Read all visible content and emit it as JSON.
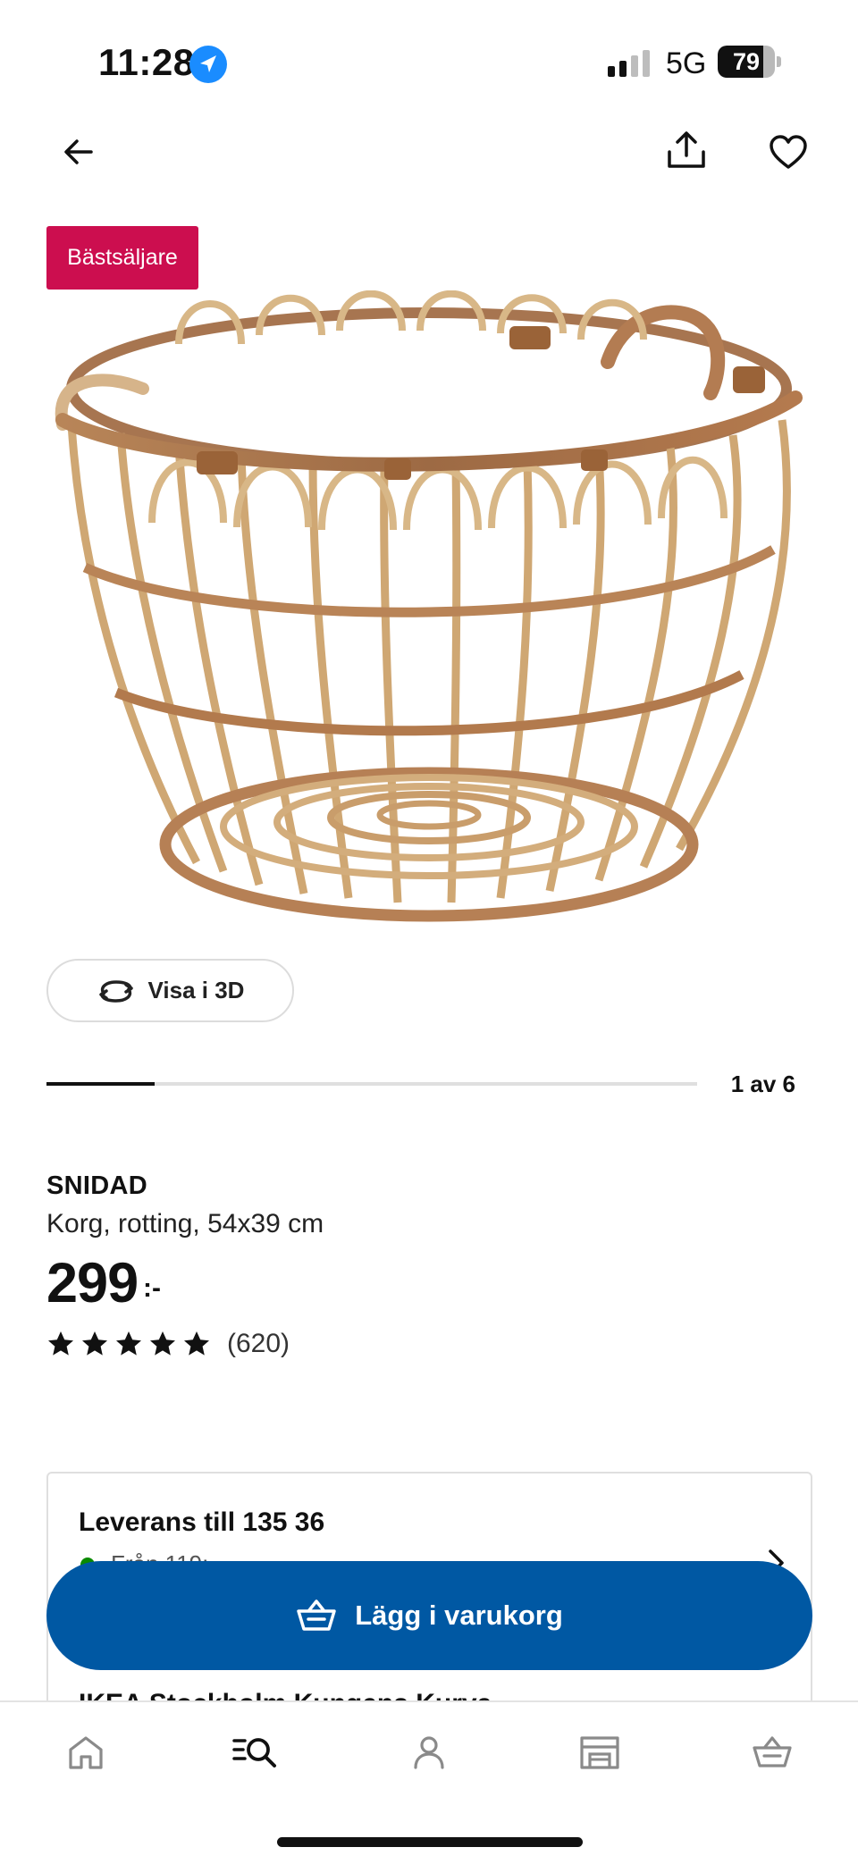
{
  "status_bar": {
    "time": "11:28",
    "network": "5G",
    "battery": "79",
    "battery_level": 0.79
  },
  "product": {
    "badge": "Bästsäljare",
    "view_3d_label": "Visa i 3D",
    "carousel": {
      "counter": "1 av 6",
      "current": 1,
      "total": 6
    },
    "name": "SNIDAD",
    "description": "Korg, rotting, 54x39 cm",
    "price": "299",
    "price_suffix": ":-",
    "rating": {
      "stars": 5,
      "max": 5,
      "count": "(620)"
    }
  },
  "delivery": {
    "title": "Leverans till 135 36",
    "subtitle": "Från 119:-",
    "store_title": "IKEA Stockholm Kungens Kurva"
  },
  "cta": {
    "add_to_cart": "Lägg i varukorg"
  },
  "tab_bar": {
    "items": [
      {
        "icon": "home-icon",
        "active": false
      },
      {
        "icon": "search-icon",
        "active": true
      },
      {
        "icon": "profile-icon",
        "active": false
      },
      {
        "icon": "store-icon",
        "active": false
      },
      {
        "icon": "cart-icon",
        "active": false
      }
    ]
  },
  "colors": {
    "badge": "#cc0e4f",
    "primary_button": "#0058a3",
    "stock_dot": "#0a8a00",
    "inactive_icon": "#8a8a8a"
  }
}
